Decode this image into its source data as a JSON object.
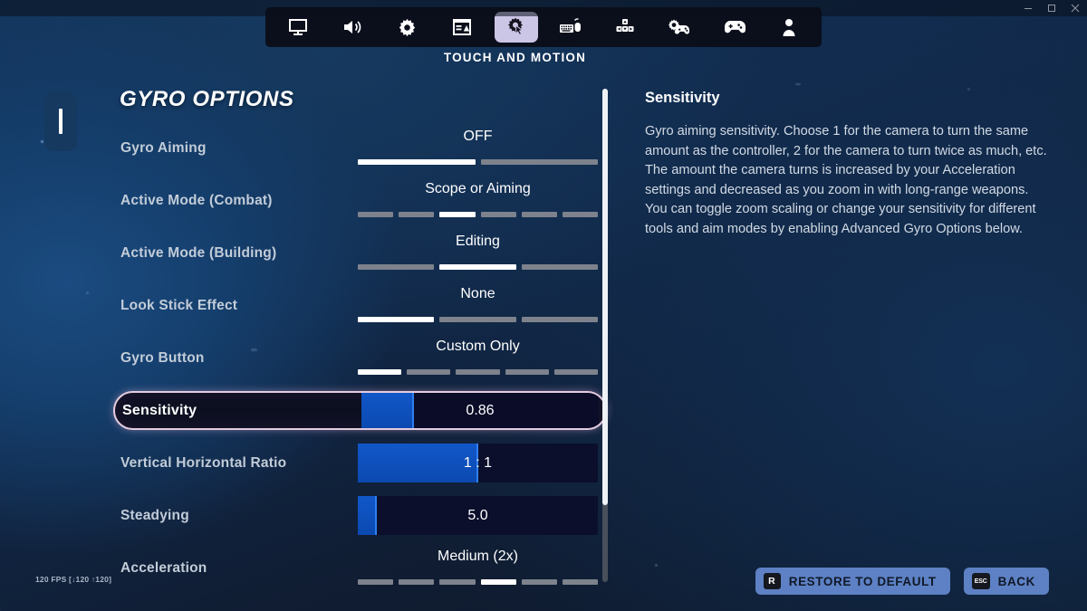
{
  "window": {
    "minimize_icon": "minimize-icon",
    "maximize_icon": "maximize-icon",
    "close_icon": "close-icon"
  },
  "tabbar": {
    "caption": "TOUCH AND MOTION",
    "tabs": [
      {
        "icon": "monitor-icon",
        "name": "video",
        "active": false
      },
      {
        "icon": "speaker-icon",
        "name": "audio",
        "active": false
      },
      {
        "icon": "gear-icon",
        "name": "game",
        "active": false
      },
      {
        "icon": "interface-icon",
        "name": "brightness-ui",
        "active": false
      },
      {
        "icon": "gear-hand-icon",
        "name": "touch-and-motion",
        "active": true
      },
      {
        "icon": "keyboard-mouse-icon",
        "name": "keyboard-mouse",
        "active": false
      },
      {
        "icon": "keybinds-icon",
        "name": "keyboard-controls",
        "active": false
      },
      {
        "icon": "controller-gear-icon",
        "name": "controller-options",
        "active": false
      },
      {
        "icon": "controller-icon",
        "name": "controller-binds",
        "active": false
      },
      {
        "icon": "account-icon",
        "name": "account",
        "active": false
      }
    ]
  },
  "panel": {
    "title": "GYRO OPTIONS",
    "rows": [
      {
        "label": "Gyro Aiming",
        "type": "option",
        "value": "OFF",
        "segments": 2,
        "active_segment": 1
      },
      {
        "label": "Active Mode (Combat)",
        "type": "option",
        "value": "Scope or Aiming",
        "segments": 6,
        "active_segment": 3
      },
      {
        "label": "Active Mode (Building)",
        "type": "option",
        "value": "Editing",
        "segments": 3,
        "active_segment": 2
      },
      {
        "label": "Look Stick Effect",
        "type": "option",
        "value": "None",
        "segments": 3,
        "active_segment": 1
      },
      {
        "label": "Gyro Button",
        "type": "option",
        "value": "Custom Only",
        "segments": 5,
        "active_segment": 1
      },
      {
        "label": "Sensitivity",
        "type": "slider",
        "value": "0.86",
        "fill_percent": 22,
        "selected": true
      },
      {
        "label": "Vertical Horizontal Ratio",
        "type": "slider",
        "value": "1 : 1",
        "fill_percent": 50,
        "selected": false
      },
      {
        "label": "Steadying",
        "type": "slider",
        "value": "5.0",
        "fill_percent": 8,
        "selected": false
      },
      {
        "label": "Acceleration",
        "type": "option",
        "value": "Medium (2x)",
        "segments": 6,
        "active_segment": 4
      }
    ]
  },
  "description": {
    "title": "Sensitivity",
    "body": "Gyro aiming sensitivity. Choose 1 for the camera to turn the same amount as the controller, 2 for the camera to turn twice as much, etc. The amount the camera turns is increased by your Acceleration settings and decreased as you zoom in with long-range weapons. You can toggle zoom scaling or change your sensitivity for different tools and aim modes by enabling Advanced Gyro Options below."
  },
  "footer": {
    "buttons": [
      {
        "key": "R",
        "label": "RESTORE TO DEFAULT",
        "name": "restore-to-default-button"
      },
      {
        "key": "ESC",
        "label": "BACK",
        "name": "back-button"
      }
    ]
  },
  "hud": {
    "fps": "120 FPS [↓120 ↑120]"
  },
  "colors": {
    "accent_blue": "#1157c9",
    "selected_border": "#e4ccdf",
    "tab_active_bg": "#ccc6e6",
    "button_bg": "#5d81c4"
  }
}
